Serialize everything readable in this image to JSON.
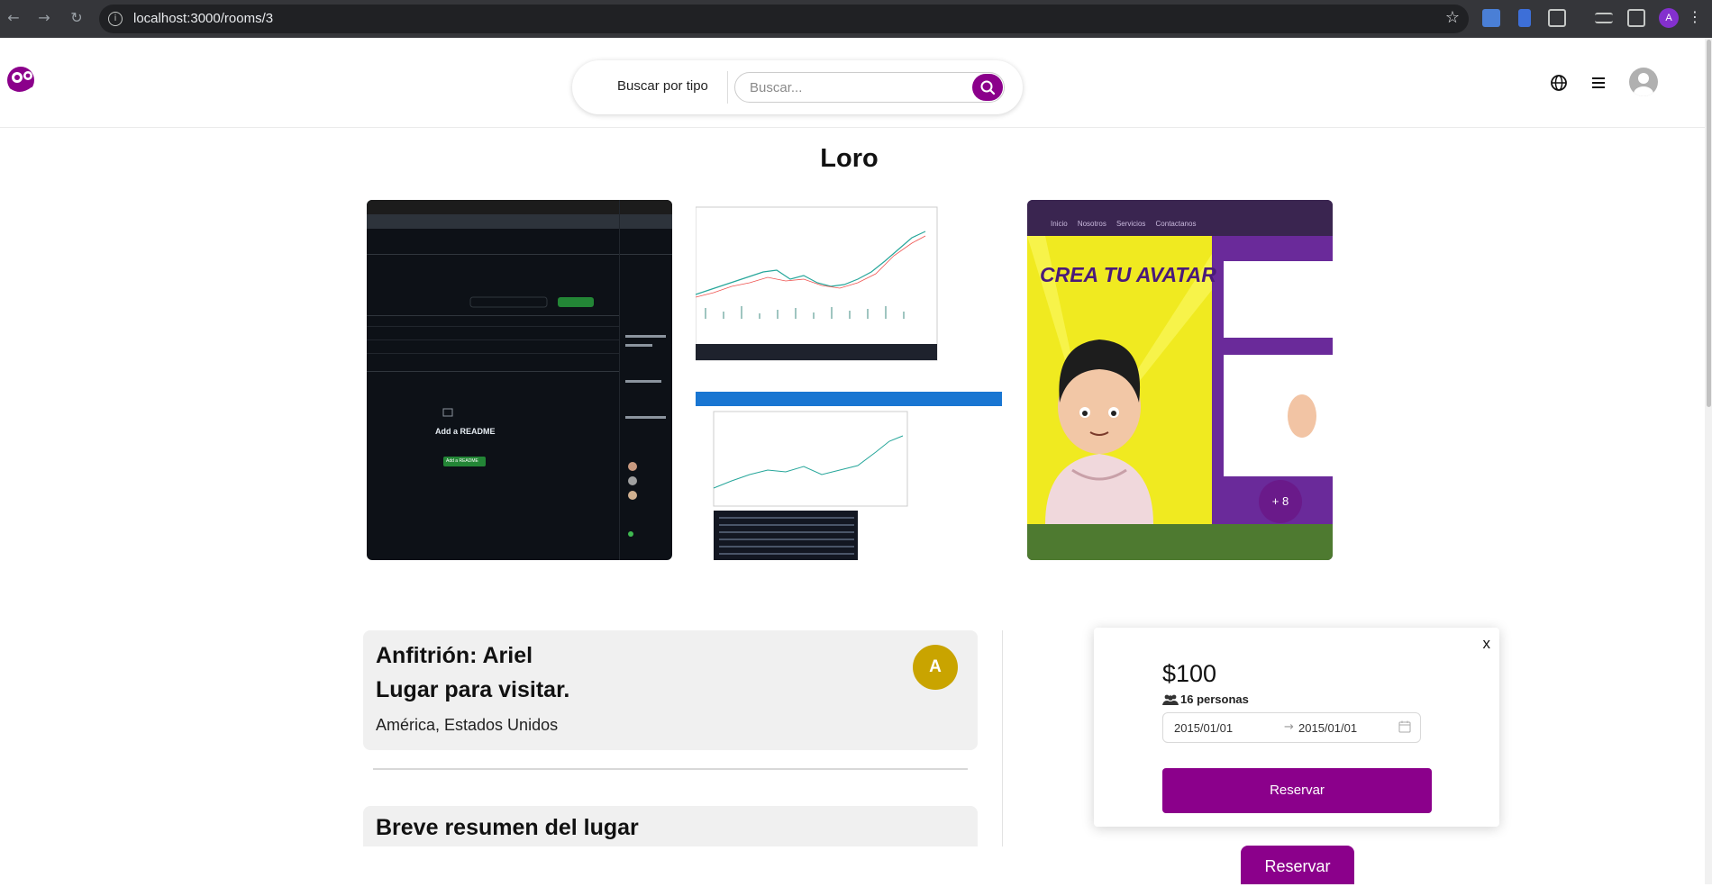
{
  "browser": {
    "url": "localhost:3000/rooms/3",
    "profile_initial": "A"
  },
  "header": {
    "search_type_label": "Buscar por tipo",
    "search_placeholder": "Buscar..."
  },
  "room": {
    "title": "Loro",
    "more_photos": "+ 8"
  },
  "gallery": {
    "readme_title": "Add a README",
    "readme_button": "Add a README",
    "avatar_banner": "CREA TU AVATAR",
    "avatar_nav": [
      "Inicio",
      "Nosotros",
      "Servicios",
      "Contactanos"
    ]
  },
  "host": {
    "host_line": "Anfitrión: Ariel",
    "place_line": "Lugar para visitar.",
    "location": "América, Estados Unidos",
    "avatar_initial": "A"
  },
  "summary": {
    "title": "Breve resumen del lugar"
  },
  "booking": {
    "close": "x",
    "price": "$100",
    "guests": "16 personas",
    "date_start": "2015/01/01",
    "date_end": "2015/01/01",
    "reserve_label": "Reservar",
    "reserve_float_label": "Reservar"
  },
  "colors": {
    "brand": "#8b008b",
    "host_avatar": "#c9a400"
  }
}
